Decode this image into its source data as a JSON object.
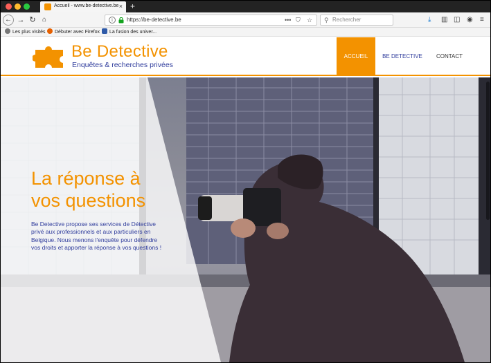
{
  "browser": {
    "tab_title": "Accueil - www.be-detective.be",
    "url": "https://be-detective.be",
    "search_placeholder": "Rechercher",
    "bookmarks": [
      {
        "label": "Les plus visités"
      },
      {
        "label": "Débuter avec Firefox"
      },
      {
        "label": "La fusion des univer..."
      }
    ]
  },
  "site": {
    "brand": "Be Detective",
    "tagline": "Enquêtes & recherches privées",
    "nav": [
      {
        "label": "ACCUEIL",
        "active": true
      },
      {
        "label": "BE DETECTIVE",
        "active": false
      },
      {
        "label": "CONTACT",
        "active": false
      }
    ],
    "accent_color": "#f39200",
    "secondary_color": "#2f3c9c"
  },
  "hero": {
    "title": "La réponse à vos questions",
    "text": "Be Detective propose ses services de Détective privé aux professionnels et aux particuliers en Belgique. Nous menons l'enquête pour défendre vos droits et apporter la réponse à vos questions !"
  }
}
